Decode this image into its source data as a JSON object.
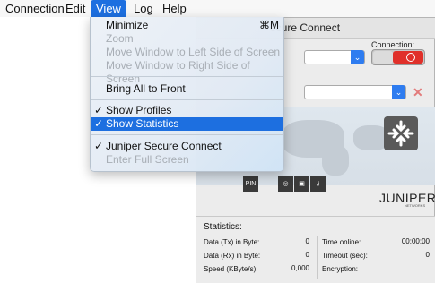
{
  "menubar": {
    "items": [
      "Connection",
      "Edit",
      "View",
      "Log",
      "Help"
    ],
    "active": "View"
  },
  "view_menu": {
    "minimize": {
      "label": "Minimize",
      "shortcut": "⌘M"
    },
    "zoom": {
      "label": "Zoom"
    },
    "move_left": {
      "label": "Move Window to Left Side of Screen"
    },
    "move_right": {
      "label": "Move Window to Right Side of Screen"
    },
    "bring_all": {
      "label": "Bring All to Front"
    },
    "show_profiles": {
      "label": "Show Profiles",
      "checked": "✓"
    },
    "show_statistics": {
      "label": "Show Statistics",
      "checked": "✓"
    },
    "juniper": {
      "label": "Juniper Secure Connect",
      "checked": "✓"
    },
    "full_screen": {
      "label": "Enter Full Screen"
    }
  },
  "window": {
    "title": "ecure Connect",
    "connection_label": "Connection:",
    "brand": "JUNIPER",
    "brand_sub": "NETWORKS",
    "pin_label": "PIN",
    "accent": "#e0302a"
  },
  "statistics": {
    "title": "Statistics:",
    "tx_label": "Data (Tx) in Byte:",
    "tx_value": "0",
    "rx_label": "Data (Rx) in Byte:",
    "rx_value": "0",
    "speed_label": "Speed (KByte/s):",
    "speed_value": "0,000",
    "online_label": "Time online:",
    "online_value": "00:00:00",
    "timeout_label": "Timeout (sec):",
    "timeout_value": "0",
    "encryption_label": "Encryption:",
    "encryption_value": ""
  }
}
